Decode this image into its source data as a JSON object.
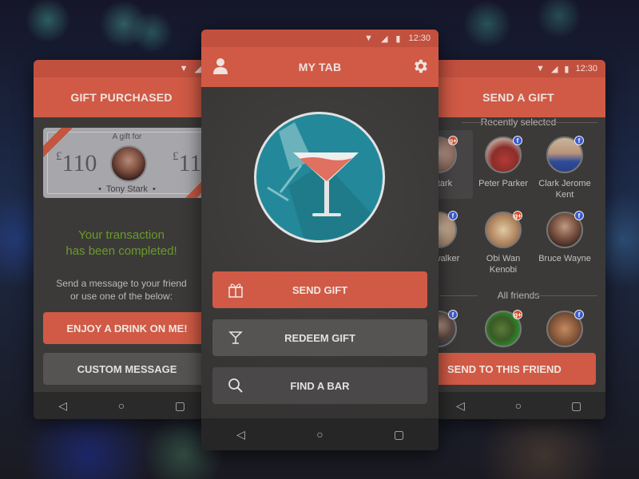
{
  "status": {
    "time": "12:30"
  },
  "left_screen": {
    "title": "GIFT PURCHASED",
    "voucher": {
      "caption": "A gift for",
      "currency": "£",
      "amount": "110",
      "amount_right_partial": "11",
      "recipient": "Tony Stark",
      "bullet": "•"
    },
    "completed_line1": "Your transaction",
    "completed_line2": "has been completed!",
    "message_line1": "Send a message to your friend",
    "message_line2": "or use one of the below:",
    "buttons": {
      "enjoy": "ENJOY A DRINK ON ME!",
      "custom": "CUSTOM MESSAGE"
    }
  },
  "center_screen": {
    "title": "MY TAB",
    "buttons": [
      {
        "label": "SEND GIFT",
        "icon": "gift-icon"
      },
      {
        "label": "REDEEM GIFT",
        "icon": "cocktail-icon"
      },
      {
        "label": "FIND A BAR",
        "icon": "search-icon"
      }
    ]
  },
  "right_screen": {
    "title": "SEND A GIFT",
    "recent_heading": "Recently selected",
    "recent": [
      {
        "name": "y Stark",
        "network": "google-plus",
        "selected": true
      },
      {
        "name": "Peter Parker",
        "network": "facebook"
      },
      {
        "name": "Clark Jerome Kent",
        "network": "facebook"
      },
      {
        "name": "uke walker",
        "network": "facebook"
      },
      {
        "name": "Obi Wan Kenobi",
        "network": "google-plus"
      },
      {
        "name": "Bruce Wayne",
        "network": "facebook"
      }
    ],
    "all_heading": "All friends",
    "all": [
      {
        "network": "facebook"
      },
      {
        "network": "google-plus"
      },
      {
        "network": "facebook"
      }
    ],
    "send_button": "SEND TO THIS FRIEND"
  },
  "badges": {
    "facebook": "f",
    "google-plus": "g+"
  },
  "nav": {
    "back": "◁",
    "home": "○",
    "recents": "▢"
  },
  "colors": {
    "accent": "#d05a45",
    "success": "#6a9a2a",
    "teal": "#23899a"
  }
}
